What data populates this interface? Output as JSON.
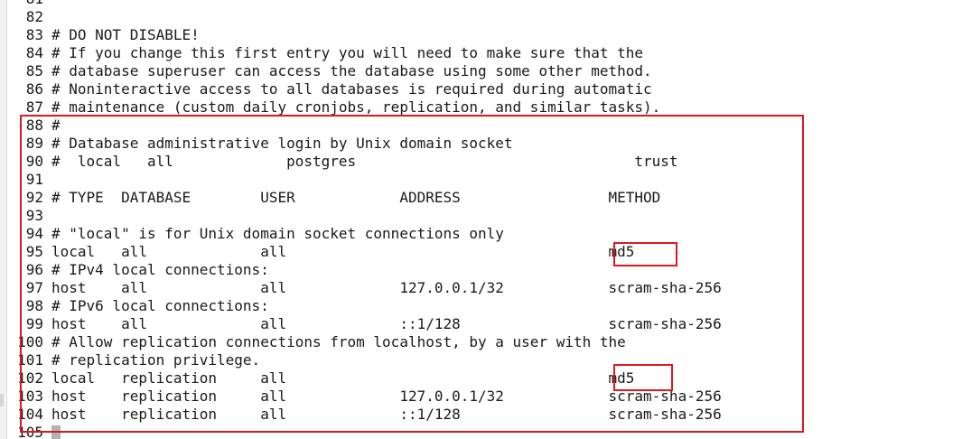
{
  "lines": [
    {
      "n": "81",
      "text": ""
    },
    {
      "n": "82",
      "text": ""
    },
    {
      "n": "83",
      "text": "# DO NOT DISABLE!"
    },
    {
      "n": "84",
      "text": "# If you change this first entry you will need to make sure that the"
    },
    {
      "n": "85",
      "text": "# database superuser can access the database using some other method."
    },
    {
      "n": "86",
      "text": "# Noninteractive access to all databases is required during automatic"
    },
    {
      "n": "87",
      "text": "# maintenance (custom daily cronjobs, replication, and similar tasks)."
    },
    {
      "n": "88",
      "text": "#"
    },
    {
      "n": "89",
      "text": "# Database administrative login by Unix domain socket"
    },
    {
      "n": "90",
      "text": "#  local   all             postgres                                trust"
    },
    {
      "n": "91",
      "text": ""
    },
    {
      "n": "92",
      "text": "# TYPE  DATABASE        USER            ADDRESS                 METHOD"
    },
    {
      "n": "93",
      "text": ""
    },
    {
      "n": "94",
      "text": "# \"local\" is for Unix domain socket connections only"
    },
    {
      "n": "95",
      "text": "local   all             all                                     md5"
    },
    {
      "n": "96",
      "text": "# IPv4 local connections:"
    },
    {
      "n": "97",
      "text": "host    all             all             127.0.0.1/32            scram-sha-256"
    },
    {
      "n": "98",
      "text": "# IPv6 local connections:"
    },
    {
      "n": "99",
      "text": "host    all             all             ::1/128                 scram-sha-256"
    },
    {
      "n": "100",
      "text": "# Allow replication connections from localhost, by a user with the"
    },
    {
      "n": "101",
      "text": "# replication privilege."
    },
    {
      "n": "102",
      "text": "local   replication     all                                     md5"
    },
    {
      "n": "103",
      "text": "host    replication     all             127.0.0.1/32            scram-sha-256"
    },
    {
      "n": "104",
      "text": "host    replication     all             ::1/128                 scram-sha-256"
    },
    {
      "n": "105",
      "text": ""
    }
  ],
  "colors": {
    "highlight_border": "#e0171f",
    "text": "#1a1a1a",
    "cursor": "#b3b3b3"
  }
}
